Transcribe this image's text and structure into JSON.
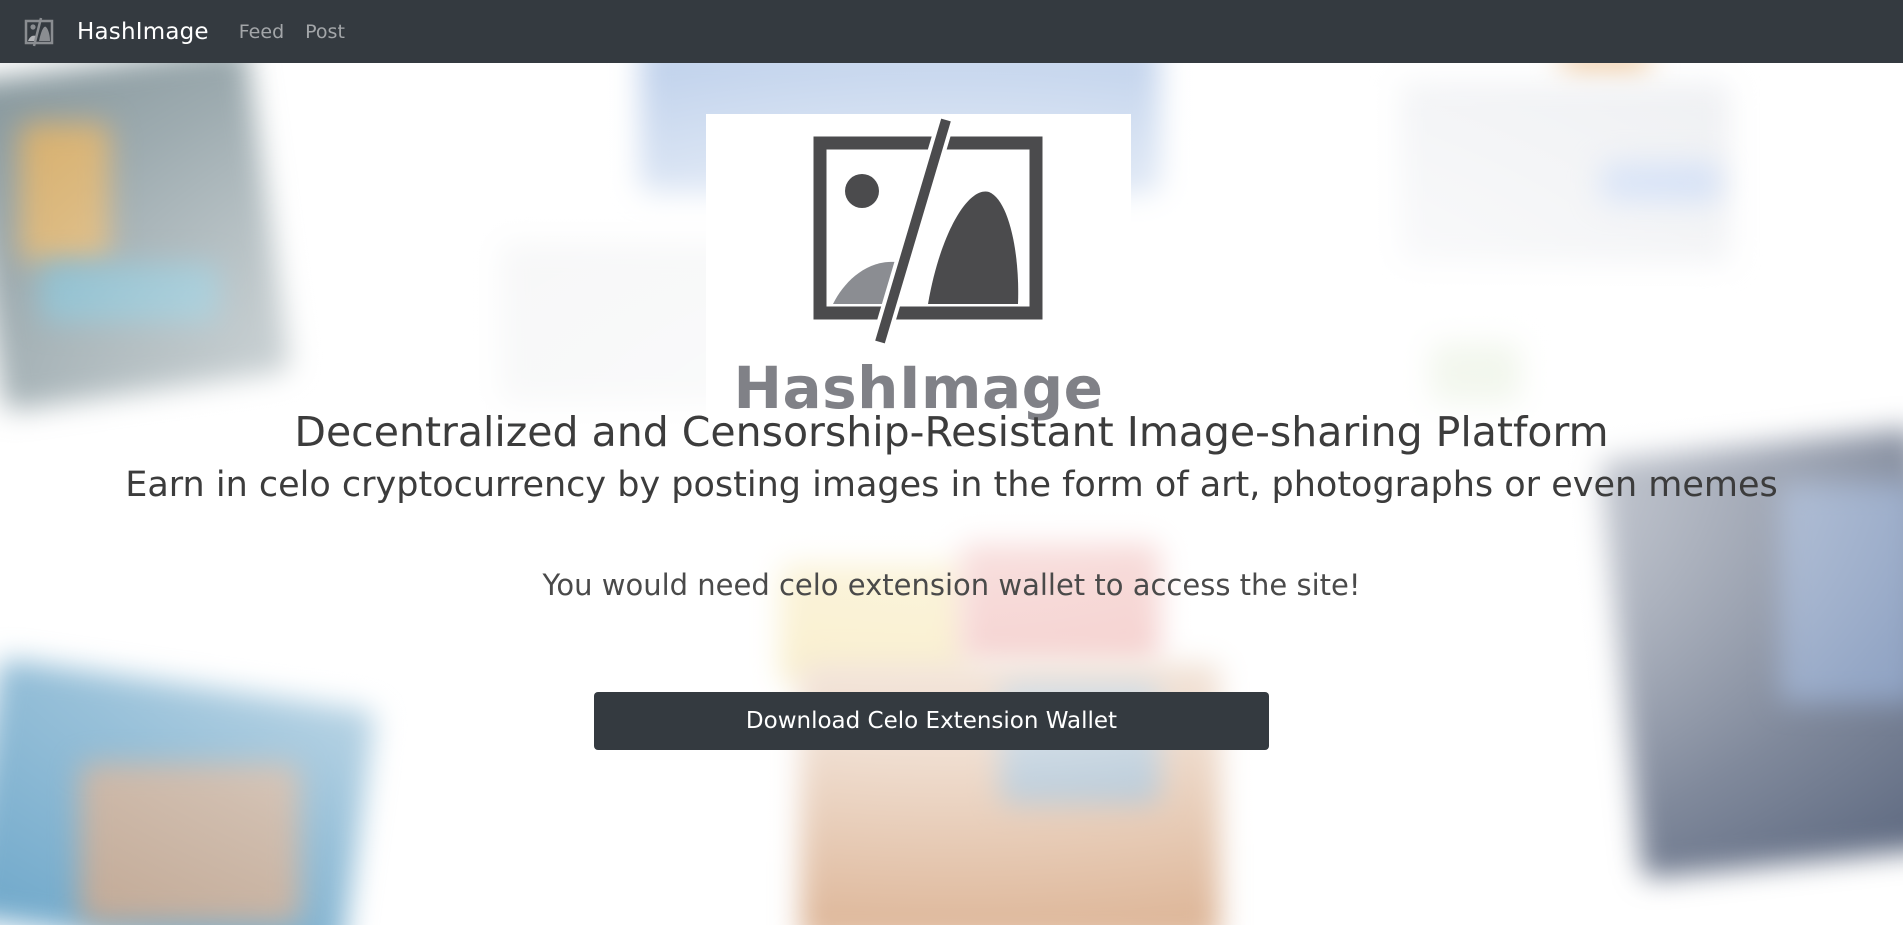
{
  "navbar": {
    "brand": "HashImage",
    "links": [
      "Feed",
      "Post"
    ],
    "logo_icon": "image-slash-icon",
    "background": "#343a40"
  },
  "hero": {
    "logo_word": "HashImage",
    "logo_icon": "image-slash-icon",
    "logo_color": "#4b4b4d",
    "headline": "Decentralized and Censorship-Resistant Image-sharing Platform",
    "subline": "Earn in celo cryptocurrency by posting images in the form of art, photographs or even memes",
    "notice": "You would need celo extension wallet to access the site!",
    "download_label": "Download Celo Extension Wallet",
    "button_color": "#343a40"
  }
}
